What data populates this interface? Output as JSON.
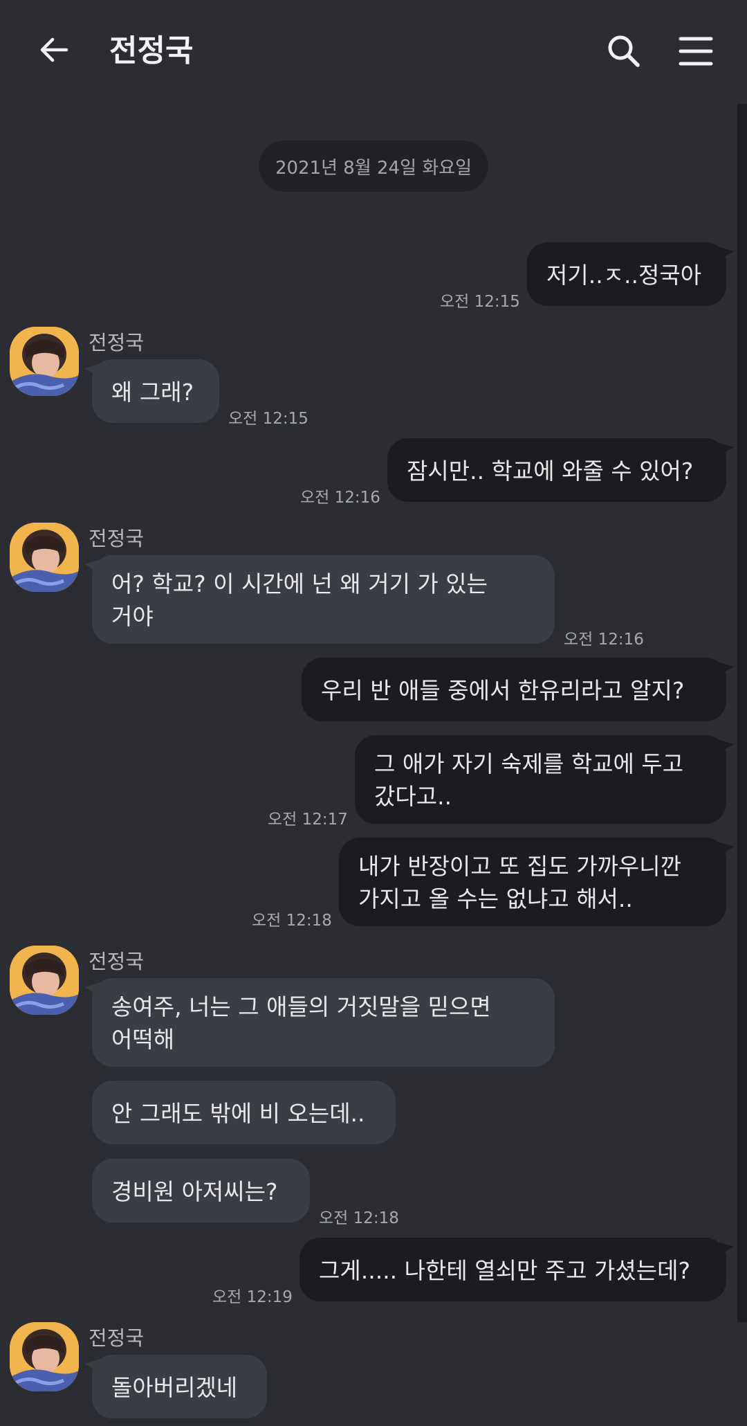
{
  "header": {
    "title": "전정국"
  },
  "date_divider": "2021년 8월 24일 화요일",
  "sender_name": "전정국",
  "messages": [
    {
      "text": "저기..ㅈ..정국아",
      "time": "오전 12:15"
    },
    {
      "text": "왜 그래?",
      "time": "오전 12:15"
    },
    {
      "text": "잠시만.. 학교에 와줄 수 있어?",
      "time": "오전 12:16"
    },
    {
      "line1": "어? 학교? 이 시간에 넌 왜 거기 가 있는",
      "line2": "거야",
      "time": "오전 12:16"
    },
    {
      "text": "우리 반 애들 중에서 한유리라고 알지?"
    },
    {
      "line1": "그 애가 자기 숙제를 학교에 두고",
      "line2": "갔다고..",
      "time": "오전 12:17"
    },
    {
      "line1": "내가 반장이고 또 집도 가까우니깐",
      "line2": "가지고 올 수는 없냐고 해서..",
      "time": "오전 12:18"
    },
    {
      "line1": "송여주, 너는 그 애들의 거짓말을 믿으면",
      "line2": "어떡해"
    },
    {
      "text": "안 그래도 밖에 비 오는데.."
    },
    {
      "text": "경비원 아저씨는?",
      "time": "오전 12:18"
    },
    {
      "text": "그게..... 나한테 열쇠만 주고 가셨는데?",
      "time": "오전 12:19"
    },
    {
      "text": "돌아버리겠네"
    }
  ],
  "icons": {
    "back": "arrow-left-icon",
    "search": "search-icon",
    "menu": "hamburger-menu-icon",
    "avatar": "profile-photo"
  },
  "colors": {
    "background": "#2b2d33",
    "my_bubble": "#1b1c20",
    "their_bubble": "#3b3d44"
  }
}
